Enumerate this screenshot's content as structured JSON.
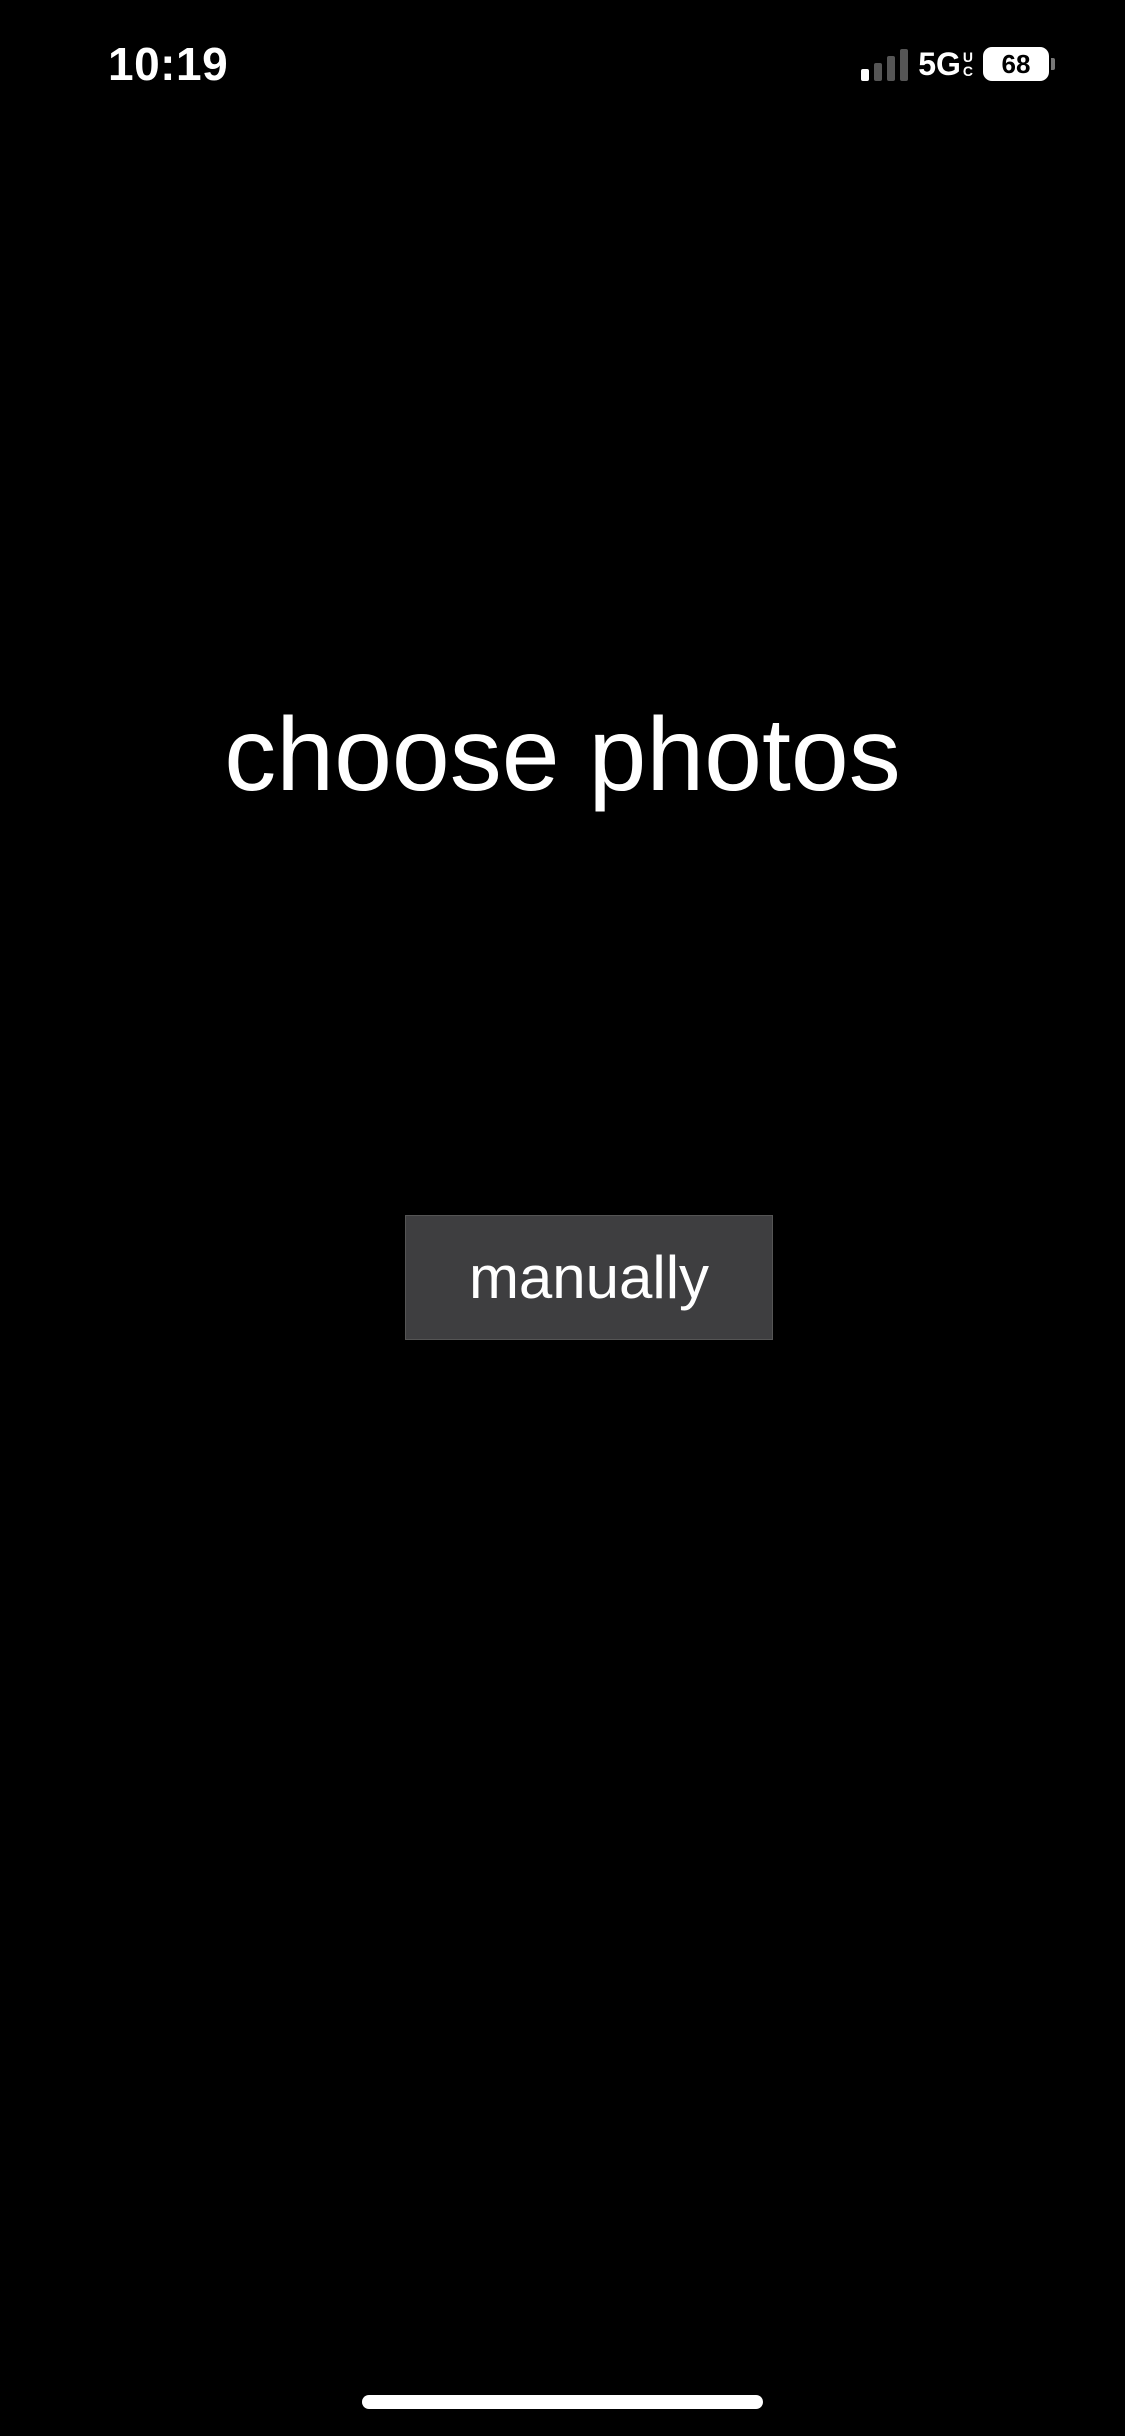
{
  "status_bar": {
    "time": "10:19",
    "network": "5G",
    "network_badge_top": "U",
    "network_badge_bottom": "C",
    "battery_level": "68",
    "signal_bars_active": 1,
    "signal_bars_total": 4
  },
  "main": {
    "title": "choose photos",
    "manual_button_label": "manually"
  },
  "colors": {
    "background": "#000000",
    "text": "#ffffff",
    "button_background": "#3e3e40"
  }
}
